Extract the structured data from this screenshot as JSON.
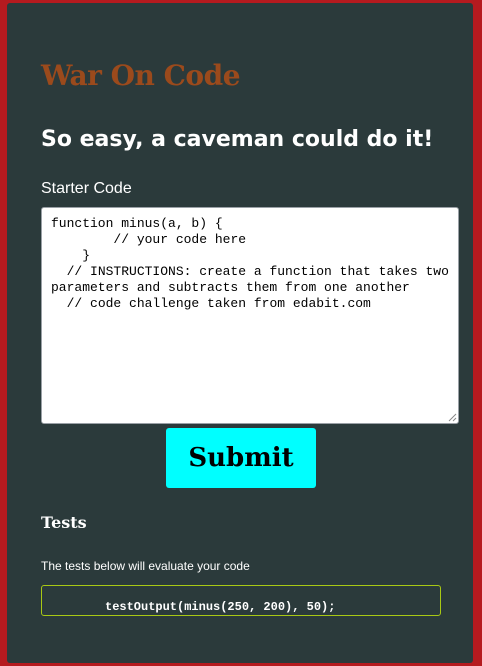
{
  "header": {
    "title": "War On Code",
    "subtitle": "So easy, a caveman could do it!"
  },
  "editor": {
    "label": "Starter Code",
    "code": "function minus(a, b) {\n        // your code here\n    }\n  // INSTRUCTIONS: create a function that takes two parameters and subtracts them from one another\n  // code challenge taken from edabit.com"
  },
  "actions": {
    "submit_label": "Submit"
  },
  "tests": {
    "heading": "Tests",
    "description": "The tests below will evaluate your code",
    "items": [
      "testOutput(minus(250, 200), 50);"
    ]
  },
  "colors": {
    "page_background": "#b51a1f",
    "card_background": "#2b3a3b",
    "title": "#9b4a1c",
    "submit_button": "#00ffff",
    "test_border": "#a8c814"
  }
}
